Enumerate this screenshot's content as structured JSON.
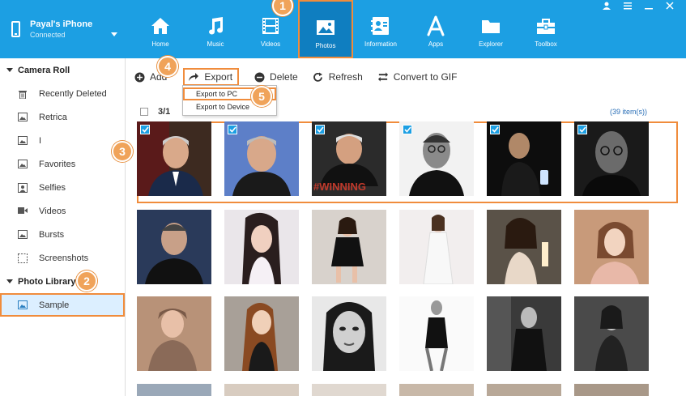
{
  "device": {
    "name": "Payal's iPhone",
    "status": "Connected"
  },
  "nav": [
    {
      "label": "Home",
      "icon": "home-icon"
    },
    {
      "label": "Music",
      "icon": "music-icon"
    },
    {
      "label": "Videos",
      "icon": "film-icon"
    },
    {
      "label": "Photos",
      "icon": "photo-icon",
      "active": true
    },
    {
      "label": "Information",
      "icon": "contacts-icon"
    },
    {
      "label": "Apps",
      "icon": "apps-icon"
    },
    {
      "label": "Explorer",
      "icon": "folder-icon"
    },
    {
      "label": "Toolbox",
      "icon": "toolbox-icon"
    }
  ],
  "sidebar": {
    "camera_roll": "Camera Roll",
    "items": [
      "Recently Deleted",
      "Retrica",
      "I",
      "Favorites",
      "Selfies",
      "Videos",
      "Bursts",
      "Screenshots"
    ],
    "photo_library": "Photo Library",
    "library_items": [
      "Sample"
    ]
  },
  "toolbar": {
    "add": "Add",
    "export": "Export",
    "delete": "Delete",
    "refresh": "Refresh",
    "convert": "Convert to GIF"
  },
  "export_menu": {
    "to_pc": "Export to PC",
    "to_device": "Export to Device"
  },
  "list": {
    "page": "3/1",
    "count": "(39 item(s))"
  },
  "photo_text": "#WINNING",
  "callouts": [
    "1",
    "2",
    "3",
    "4",
    "5"
  ],
  "colors": {
    "accent": "#1c9fe3",
    "highlight": "#f08c3c",
    "callout": "#f0a35a"
  }
}
